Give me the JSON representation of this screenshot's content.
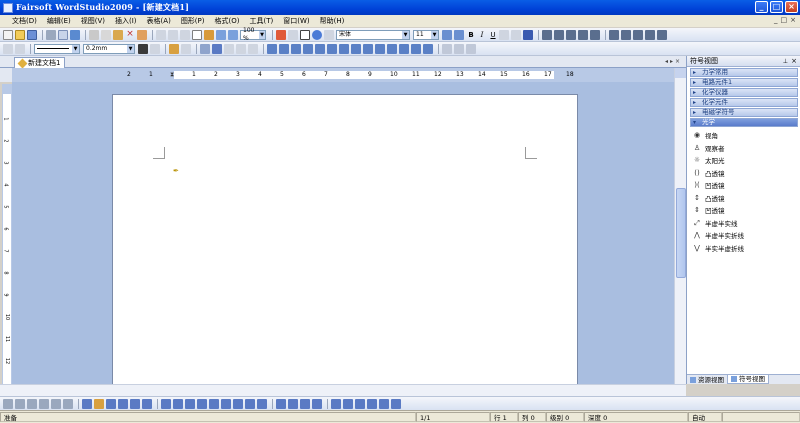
{
  "window": {
    "title": "Fairsoft WordStudio2009 - [新建文档1]",
    "buttons": {
      "minimize": "_",
      "maximize": "□",
      "close": "×"
    }
  },
  "menubar": {
    "items": [
      "文档(D)",
      "编辑(E)",
      "视图(V)",
      "插入(I)",
      "表格(A)",
      "图形(P)",
      "格式(O)",
      "工具(T)",
      "窗口(W)",
      "帮助(H)"
    ],
    "mdi_controls": [
      "_",
      "□",
      "×"
    ]
  },
  "toolbar_standard": {
    "zoom": "100 %",
    "font_name": "宋体",
    "font_size": "11",
    "bold": "B",
    "italic": "I",
    "underline": "U"
  },
  "toolbar_drawing_props": {
    "line_width": "0.2mm"
  },
  "document_tabs": [
    {
      "label": "新建文档1"
    }
  ],
  "ruler": {
    "h_labels": [
      "2",
      "1",
      "1",
      "2",
      "3",
      "4",
      "5",
      "6",
      "7",
      "8",
      "9",
      "10",
      "11",
      "12",
      "13",
      "14",
      "15",
      "16",
      "17",
      "18"
    ],
    "v_labels": [
      "1",
      "2",
      "3",
      "4",
      "5",
      "6",
      "7",
      "8",
      "9",
      "10",
      "11",
      "12"
    ]
  },
  "symbol_panel": {
    "title": "符号视图",
    "categories": [
      {
        "label": "力学常用",
        "open": false
      },
      {
        "label": "电路元件1",
        "open": false
      },
      {
        "label": "化学仪器",
        "open": false
      },
      {
        "label": "化学元件",
        "open": false
      },
      {
        "label": "电磁学符号",
        "open": false
      },
      {
        "label": "光学",
        "open": true
      }
    ],
    "symbols": [
      "视角",
      "观察者",
      "太阳光",
      "凸透镜",
      "凹透镜",
      "凸透镜",
      "凹透镜",
      "半虚半实线",
      "半虚半实折线",
      "半实半虚折线"
    ],
    "tabs": [
      {
        "label": "资源视图",
        "active": false
      },
      {
        "label": "符号视图",
        "active": true
      }
    ]
  },
  "statusbar": {
    "ready": "准备",
    "page": "1/1",
    "row_label": "行 1",
    "col_label": "列 0",
    "level_label": "级别 0",
    "depth_label": "深度 0",
    "mode": "自动"
  }
}
